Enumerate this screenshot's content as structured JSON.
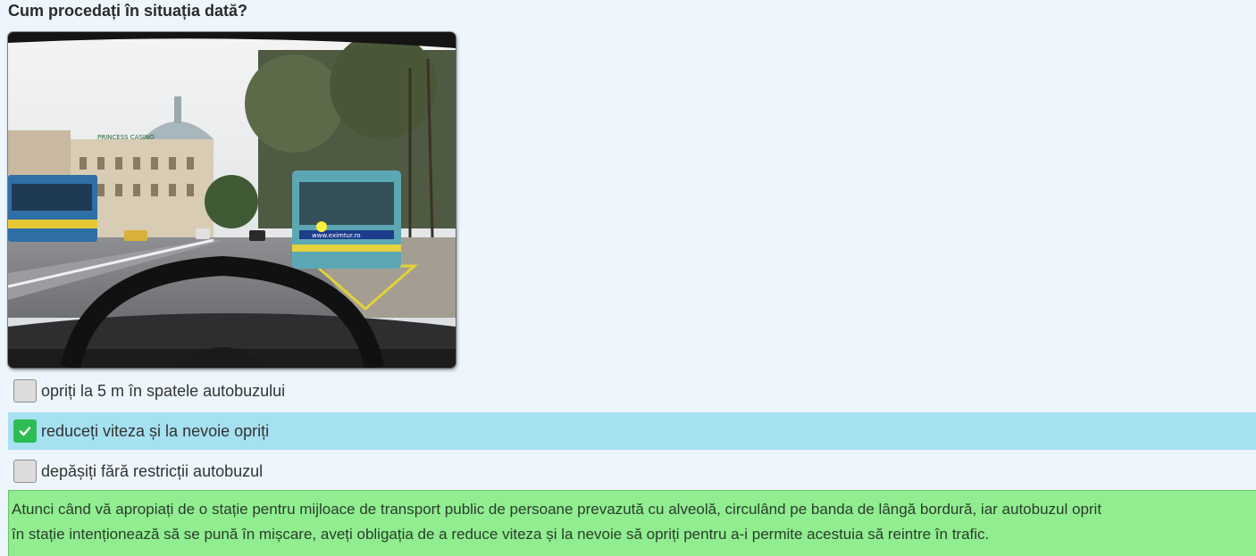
{
  "question": {
    "text": "Cum procedați în situația dată?"
  },
  "image": {
    "alt": "scenă de trafic: autobuz oprit în stație pe banda din dreapta",
    "bus_sign": "www.eximtur.ro",
    "building_sign": "PRINCESS CASINO"
  },
  "answers": [
    {
      "label": "opriți la 5 m în spatele autobuzului",
      "checked": false
    },
    {
      "label": "reduceți viteza și la nevoie opriți",
      "checked": true
    },
    {
      "label": "depășiți fără restricții autobuzul",
      "checked": false
    }
  ],
  "explanation": {
    "line1": "Atunci când vă apropiați de o stație pentru mijloace de transport public de persoane prevazută cu alveolă, circulând pe banda de lângă bordură, iar autobuzul oprit",
    "line2": "în stație intenționează să se pună în mișcare, aveți obligația de a reduce viteza și la nevoie să opriți pentru a-i permite acestuia să reintre în trafic."
  },
  "colors": {
    "selected_row": "#a6e1f1",
    "check_green": "#2ebd54",
    "explanation_bg": "#90ee90",
    "page_bg": "#eef6fd"
  }
}
